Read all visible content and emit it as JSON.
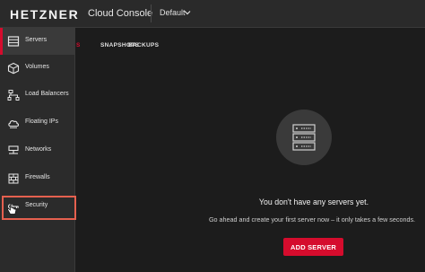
{
  "header": {
    "logo": "HETZNER",
    "product": "Cloud Console",
    "project": "Default"
  },
  "sidebar": {
    "items": [
      {
        "label": "Servers",
        "icon": "server-icon",
        "active": true
      },
      {
        "label": "Volumes",
        "icon": "cube-icon"
      },
      {
        "label": "Load Balancers",
        "icon": "load-balancer-icon"
      },
      {
        "label": "Floating IPs",
        "icon": "cloud-icon"
      },
      {
        "label": "Networks",
        "icon": "network-icon"
      },
      {
        "label": "Firewalls",
        "icon": "firewall-icon"
      },
      {
        "label": "Security",
        "icon": "key-icon",
        "highlighted": true
      }
    ]
  },
  "tabs": [
    {
      "label": "SERVERS",
      "visible_text": "S",
      "active": true
    },
    {
      "label": "SNAPSHOTS"
    },
    {
      "label": "BACKUPS"
    }
  ],
  "empty_state": {
    "title": "You don't have any servers yet.",
    "subtitle": "Go ahead and create your first server now – it only takes a few seconds.",
    "button": "ADD SERVER"
  },
  "colors": {
    "accent": "#d50c2d",
    "highlight_box": "#e5604f",
    "background": "#1b1b1b",
    "sidebar": "#2b2b2b"
  }
}
